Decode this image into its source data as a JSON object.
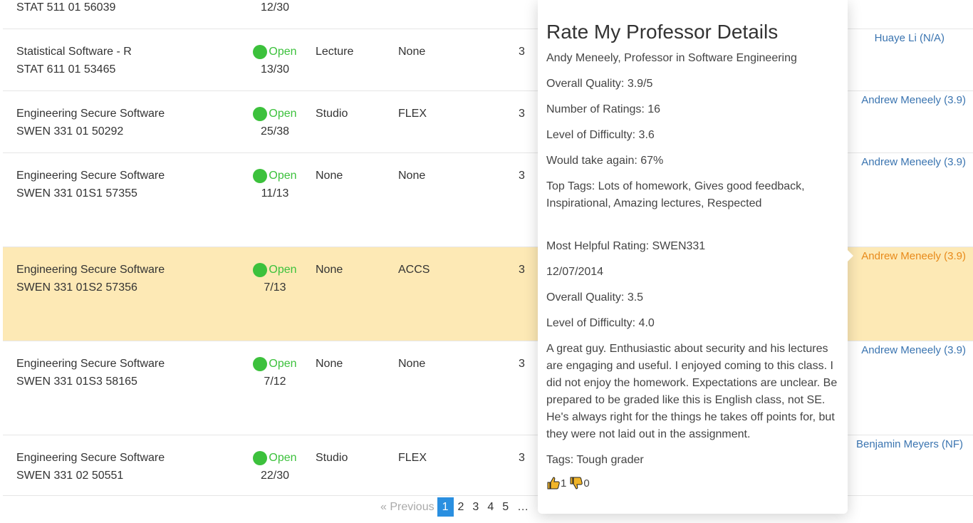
{
  "rows": [
    {
      "course": "",
      "code": "STAT 511 01 56039",
      "status": "",
      "seats": "12/30",
      "type": "",
      "mode": "",
      "credits": "",
      "professor": ""
    },
    {
      "course": "Statistical Software - R",
      "code": "STAT 611 01 53465",
      "status": "Open",
      "seats": "13/30",
      "type": "Lecture",
      "mode": "None",
      "credits": "3",
      "professor": "Huaye Li (N/A)"
    },
    {
      "course": "Engineering Secure Software",
      "code": "SWEN 331 01 50292",
      "status": "Open",
      "seats": "25/38",
      "type": "Studio",
      "mode": "FLEX",
      "credits": "3",
      "professor": "Andrew Meneely (3.9)"
    },
    {
      "course": "Engineering Secure Software",
      "code": "SWEN 331 01S1 57355",
      "status": "Open",
      "seats": "11/13",
      "type": "None",
      "mode": "None",
      "credits": "3",
      "professor": "Andrew Meneely (3.9)"
    },
    {
      "course": "Engineering Secure Software",
      "code": "SWEN 331 01S2 57356",
      "status": "Open",
      "seats": "7/13",
      "type": "None",
      "mode": "ACCS",
      "credits": "3",
      "professor": "Andrew Meneely (3.9)"
    },
    {
      "course": "Engineering Secure Software",
      "code": "SWEN 331 01S3 58165",
      "status": "Open",
      "seats": "7/12",
      "type": "None",
      "mode": "None",
      "credits": "3",
      "professor": "Andrew Meneely (3.9)"
    },
    {
      "course": "Engineering Secure Software",
      "code": "SWEN 331 02 50551",
      "status": "Open",
      "seats": "22/30",
      "type": "Studio",
      "mode": "FLEX",
      "credits": "3",
      "professor": "Benjamin Meyers (NF)"
    }
  ],
  "popover": {
    "title": "Rate My Professor Details",
    "name": "Andy Meneely, Professor in Software Engineering",
    "overall_quality": "Overall Quality: 3.9/5",
    "num_ratings": "Number of Ratings: 16",
    "difficulty": "Level of Difficulty: 3.6",
    "take_again": "Would take again: 67%",
    "top_tags": "Top Tags: Lots of homework, Gives good feedback, Inspirational, Amazing lectures, Respected",
    "helpful_rating": "Most Helpful Rating: SWEN331",
    "date": "12/07/2014",
    "rating_quality": "Overall Quality: 3.5",
    "rating_difficulty": "Level of Difficulty: 4.0",
    "comment": "A great guy. Enthusiastic about security and his lectures are engaging and useful. I enjoyed coming to this class. I did not enjoy the homework. Expectations are unclear. Be prepared to be graded like this is English class, not SE. He's always right for the things he takes off points for, but they were not laid out in the assignment.",
    "tags": "Tags: Tough grader",
    "thumbs_up": "1",
    "thumbs_down": "0"
  },
  "pagination": {
    "prev": "« Previous",
    "pages": [
      "1",
      "2",
      "3",
      "4",
      "5",
      "…"
    ],
    "active": "1"
  },
  "colors": {
    "open": "#3cc13c",
    "link": "#3a74b0",
    "highlight_row": "#fde9b5",
    "highlight_link": "#e88a1a",
    "active_page": "#2a8fe0"
  }
}
